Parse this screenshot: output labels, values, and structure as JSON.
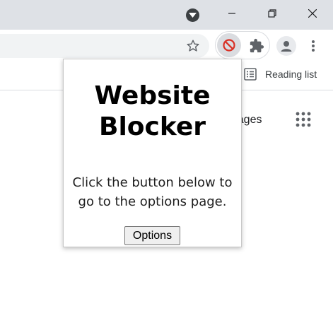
{
  "bookmarks": {
    "reading_list_label": "Reading list"
  },
  "page": {
    "images_link": "Images"
  },
  "popup": {
    "title": "Website Blocker",
    "description": "Click the button below to go to the options page.",
    "options_button": "Options"
  },
  "icons": {
    "profile_dropdown": "down-triangle-icon",
    "minimize": "minimize-icon",
    "maximize": "restore-icon",
    "close": "close-icon",
    "bookmark": "star-icon",
    "extension": "blocked-icon",
    "extensions_menu": "puzzle-icon",
    "profile": "avatar-icon",
    "menu": "kebab-icon",
    "reading_list": "list-icon",
    "apps": "apps-grid-icon"
  },
  "colors": {
    "block_red": "#d93025",
    "chrome_frame": "#dee1e6",
    "icon_gray": "#5f6368"
  }
}
